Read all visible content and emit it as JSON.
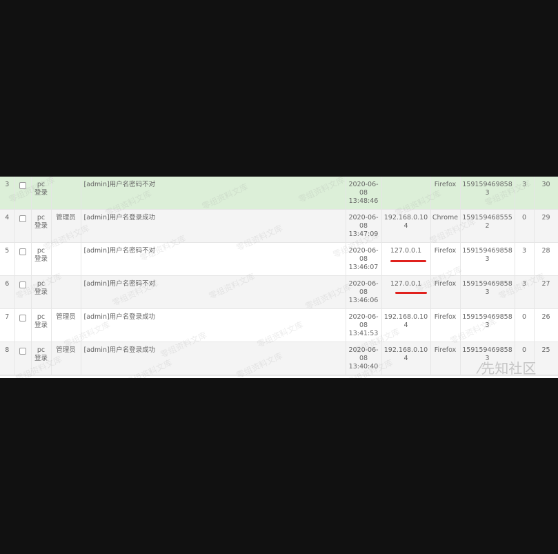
{
  "rows": [
    {
      "id": "3",
      "type": "pc\n登录",
      "user": "",
      "message": "[admin]用户名密码不对",
      "time": [
        "2020-06-",
        "08",
        "13:48:46"
      ],
      "ip": "",
      "browser": "Firefox",
      "phone": "1591594698583",
      "code": "3",
      "seq": "30",
      "highlighted": true
    },
    {
      "id": "4",
      "type": "pc\n登录",
      "user": "管理员",
      "message": "[admin]用户名登录成功",
      "time": [
        "2020-06-",
        "08",
        "13:47:09"
      ],
      "ip": "192.168.0.104",
      "browser": "Chrome",
      "phone": "1591594685552",
      "code": "0",
      "seq": "29",
      "highlighted": false
    },
    {
      "id": "5",
      "type": "pc\n登录",
      "user": "",
      "message": "[admin]用户名密码不对",
      "time": [
        "2020-06-",
        "08",
        "13:46:07"
      ],
      "ip": "127.0.0.1",
      "browser": "Firefox",
      "phone": "1591594698583",
      "code": "3",
      "seq": "28",
      "highlighted": false
    },
    {
      "id": "6",
      "type": "pc\n登录",
      "user": "",
      "message": "[admin]用户名密码不对",
      "time": [
        "2020-06-",
        "08",
        "13:46:06"
      ],
      "ip": "127.0.0.1",
      "browser": "Firefox",
      "phone": "1591594698583",
      "code": "3",
      "seq": "27",
      "highlighted": false
    },
    {
      "id": "7",
      "type": "pc\n登录",
      "user": "管理员",
      "message": "[admin]用户名登录成功",
      "time": [
        "2020-06-",
        "08",
        "13:41:53"
      ],
      "ip": "192.168.0.104",
      "browser": "Firefox",
      "phone": "1591594698583",
      "code": "0",
      "seq": "26",
      "highlighted": false
    },
    {
      "id": "8",
      "type": "pc\n登录",
      "user": "管理员",
      "message": "[admin]用户名登录成功",
      "time": [
        "2020-06-",
        "08",
        "13:40:40"
      ],
      "ip": "192.168.0.104",
      "browser": "Firefox",
      "phone": "1591594698583",
      "code": "0",
      "seq": "25",
      "highlighted": false
    }
  ],
  "watermark_text": "零组资料文库",
  "logo_text": "先知社区",
  "colors": {
    "background": "#111111",
    "highlight_row": "#dcefd8",
    "underline": "#e0211d"
  }
}
